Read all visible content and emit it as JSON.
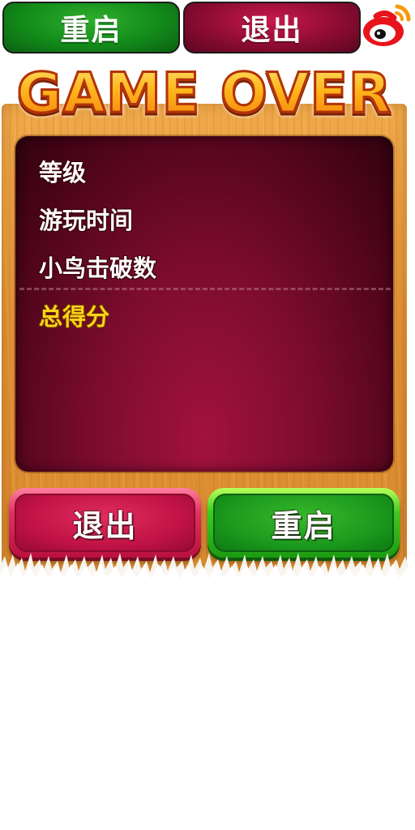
{
  "top_bar": {
    "restart_label": "重启",
    "exit_label": "退出",
    "share_icon": "weibo-icon"
  },
  "title": "GAME OVER",
  "stats": {
    "level_label": "等级",
    "play_time_label": "游玩时间",
    "birds_broken_label": "小鸟击破数",
    "total_score_label": "总得分"
  },
  "bottom_buttons": {
    "exit_label": "退出",
    "restart_label": "重启"
  },
  "colors": {
    "restart_green": "#1b9a1d",
    "exit_red": "#c21346",
    "panel_crimson": "#7d0c30",
    "wood": "#e39437",
    "title_orange": "#ffb21a",
    "total_score_yellow": "#ffd21a"
  }
}
